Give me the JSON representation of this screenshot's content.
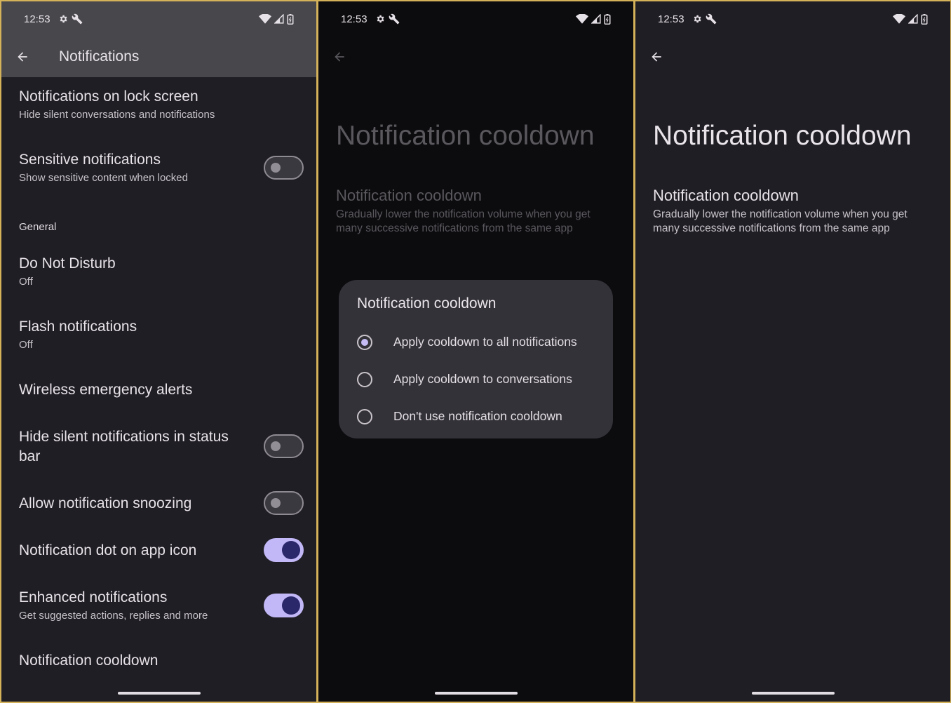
{
  "status": {
    "time": "12:53"
  },
  "screen1": {
    "title": "Notifications",
    "items": [
      {
        "title": "Notifications on lock screen",
        "subtitle": "Hide silent conversations and notifications"
      },
      {
        "title": "Sensitive notifications",
        "subtitle": "Show sensitive content when locked",
        "toggle": "off"
      },
      {
        "section": "General"
      },
      {
        "title": "Do Not Disturb",
        "subtitle": "Off"
      },
      {
        "title": "Flash notifications",
        "subtitle": "Off"
      },
      {
        "title": "Wireless emergency alerts"
      },
      {
        "title": "Hide silent notifications in status bar",
        "toggle": "off"
      },
      {
        "title": "Allow notification snoozing",
        "toggle": "off"
      },
      {
        "title": "Notification dot on app icon",
        "toggle": "on"
      },
      {
        "title": "Enhanced notifications",
        "subtitle": "Get suggested actions, replies and more",
        "toggle": "on"
      },
      {
        "title": "Notification cooldown"
      }
    ]
  },
  "screen2": {
    "big_title": "Notification cooldown",
    "pref_title": "Notification cooldown",
    "pref_subtitle": "Gradually lower the notification volume when you get many successive notifications from the same app",
    "dialog": {
      "title": "Notification cooldown",
      "options": [
        {
          "label": "Apply cooldown to all notifications",
          "selected": true
        },
        {
          "label": "Apply cooldown to conversations",
          "selected": false
        },
        {
          "label": "Don't use notification cooldown",
          "selected": false
        }
      ]
    }
  },
  "screen3": {
    "big_title": "Notification cooldown",
    "pref_title": "Notification cooldown",
    "pref_subtitle": "Gradually lower the notification volume when you get many successive notifications from the same app"
  },
  "colors": {
    "accent": "#c3b8f7",
    "knob_on": "#2a286a",
    "surface": "#1f1e24",
    "dialog": "#333238"
  }
}
